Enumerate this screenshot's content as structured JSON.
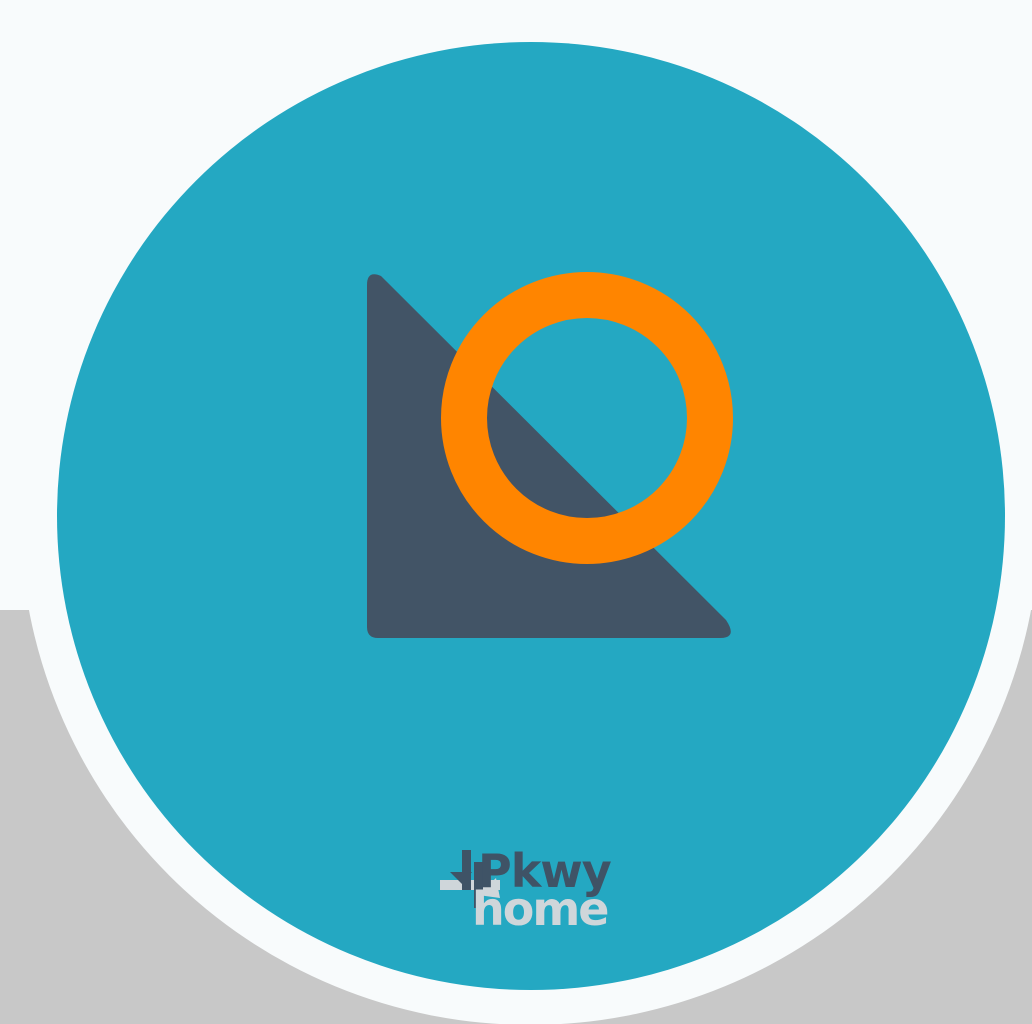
{
  "logo": {
    "icon": "triangle-ring-icon",
    "colors": {
      "background": "#24a8c2",
      "ring": "#ff8500",
      "triangle": "#425466",
      "outer_ring": "#f8fbfc",
      "page_bottom": "#c8c8c8"
    }
  },
  "brand": {
    "icon": "leaf-cross-icon",
    "line1": "Pkwy",
    "line2": "home",
    "colors": {
      "line1": "#3f5366",
      "line2": "#cfd6da"
    }
  }
}
